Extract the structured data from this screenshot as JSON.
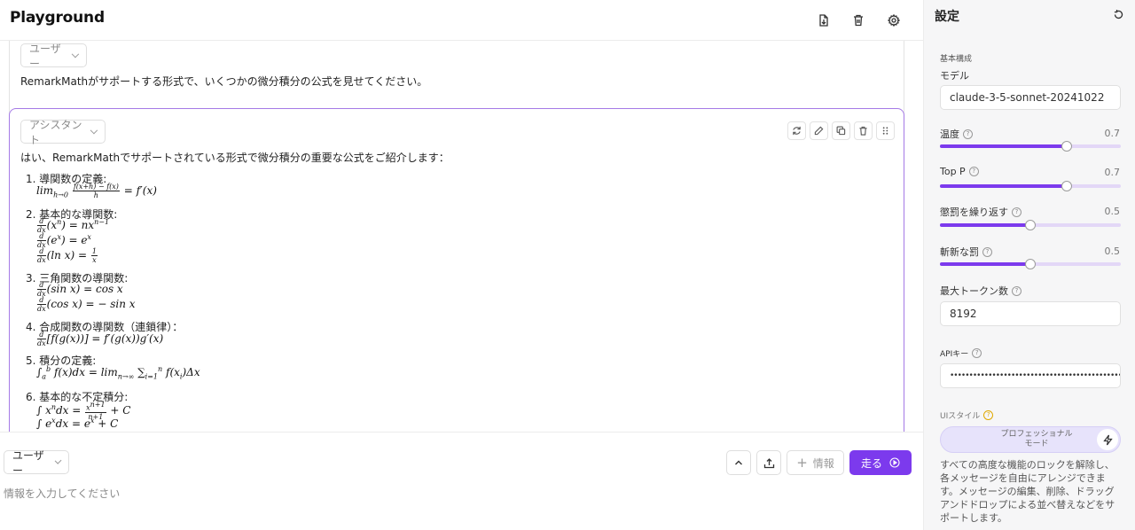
{
  "header": {
    "title": "Playground"
  },
  "messages": {
    "user": {
      "role": "ユーザー",
      "text": "RemarkMathがサポートする形式で、いくつかの微分積分の公式を見せてください。"
    },
    "assistant": {
      "role": "アシスタント",
      "intro": "はい、RemarkMathでサポートされている形式で微分積分の重要な公式をご紹介します：",
      "sections": [
        {
          "title": "1. 導関数の定義:"
        },
        {
          "title": "2. 基本的な導関数:"
        },
        {
          "title": "3. 三角関数の導関数:"
        },
        {
          "title": "4. 合成関数の導関数（連鎖律）："
        },
        {
          "title": "5. 積分の定義:"
        },
        {
          "title": "6. 基本的な不定積分:"
        }
      ]
    }
  },
  "composer": {
    "role": "ユーザー",
    "info_label": "情報",
    "run_label": "走る",
    "placeholder": "情報を入力してください"
  },
  "settings": {
    "title": "設定",
    "basic_config": "基本構成",
    "model_label": "モデル",
    "model_value": "claude-3-5-sonnet-20241022",
    "temperature": {
      "label": "温度",
      "value": "0.7",
      "fraction": 0.7
    },
    "top_p": {
      "label": "Top P",
      "value": "0.7",
      "fraction": 0.7
    },
    "repeat_penalty": {
      "label": "懲罰を繰り返す",
      "value": "0.5",
      "fraction": 0.5
    },
    "novelty_penalty": {
      "label": "斬新な罰",
      "value": "0.5",
      "fraction": 0.5
    },
    "max_tokens": {
      "label": "最大トークン数",
      "value": "8192"
    },
    "api_key": {
      "label": "APIキー",
      "value": "•••••••••••••••••••••••••••••••••••••••••••••"
    },
    "ui_style": {
      "label": "UIスタイル",
      "mode_line1": "プロフェッショナル",
      "mode_line2": "モード"
    },
    "description": "すべての高度な機能のロックを解除し、各メッセージを自由にアレンジできます。メッセージの編集、削除、ドラッグアンドドロップによる並べ替えなどをサポートします。"
  },
  "colors": {
    "accent": "#7c3aed",
    "slider_track": "#e3d7f7",
    "assistant_border": "#a57ae6"
  }
}
